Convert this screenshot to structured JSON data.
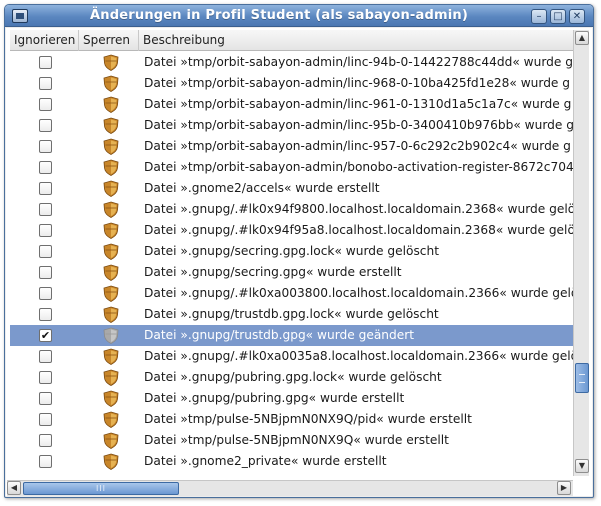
{
  "window": {
    "title": "Änderungen in Profil Student (als sabayon-admin)",
    "buttons": {
      "minimize": "–",
      "maximize": "□",
      "close": "✕"
    }
  },
  "columns": [
    "Ignorieren",
    "Sperren",
    "Beschreibung"
  ],
  "rows": [
    {
      "ignored": false,
      "lock": "shield-icon",
      "text": "Datei »tmp/orbit-sabayon-admin/linc-94b-0-14422788c44dd« wurde g"
    },
    {
      "ignored": false,
      "lock": "shield-icon",
      "text": "Datei »tmp/orbit-sabayon-admin/linc-968-0-10ba425fd1e28« wurde g"
    },
    {
      "ignored": false,
      "lock": "shield-icon",
      "text": "Datei »tmp/orbit-sabayon-admin/linc-961-0-1310d1a5c1a7c« wurde g"
    },
    {
      "ignored": false,
      "lock": "shield-icon",
      "text": "Datei »tmp/orbit-sabayon-admin/linc-95b-0-3400410b976bb« wurde g"
    },
    {
      "ignored": false,
      "lock": "shield-icon",
      "text": "Datei »tmp/orbit-sabayon-admin/linc-957-0-6c292c2b902c4« wurde g"
    },
    {
      "ignored": false,
      "lock": "shield-icon",
      "text": "Datei »tmp/orbit-sabayon-admin/bonobo-activation-register-8672c704"
    },
    {
      "ignored": false,
      "lock": "shield-icon",
      "text": "Datei ».gnome2/accels« wurde erstellt"
    },
    {
      "ignored": false,
      "lock": "shield-icon",
      "text": "Datei ».gnupg/.#lk0x94f9800.localhost.localdomain.2368« wurde gelö"
    },
    {
      "ignored": false,
      "lock": "shield-icon",
      "text": "Datei ».gnupg/.#lk0x94f95a8.localhost.localdomain.2368« wurde gelös"
    },
    {
      "ignored": false,
      "lock": "shield-icon",
      "text": "Datei ».gnupg/secring.gpg.lock« wurde gelöscht"
    },
    {
      "ignored": false,
      "lock": "shield-icon",
      "text": "Datei ».gnupg/secring.gpg« wurde erstellt"
    },
    {
      "ignored": false,
      "lock": "shield-icon",
      "text": "Datei ».gnupg/.#lk0xa003800.localhost.localdomain.2366« wurde gelö"
    },
    {
      "ignored": false,
      "lock": "shield-icon",
      "text": "Datei ».gnupg/trustdb.gpg.lock« wurde gelöscht"
    },
    {
      "ignored": true,
      "lock": "shield-icon-disabled",
      "text": "Datei ».gnupg/trustdb.gpg« wurde geändert",
      "selected": true
    },
    {
      "ignored": false,
      "lock": "shield-icon",
      "text": "Datei ».gnupg/.#lk0xa0035a8.localhost.localdomain.2366« wurde gelö"
    },
    {
      "ignored": false,
      "lock": "shield-icon",
      "text": "Datei ».gnupg/pubring.gpg.lock« wurde gelöscht"
    },
    {
      "ignored": false,
      "lock": "shield-icon",
      "text": "Datei ».gnupg/pubring.gpg« wurde erstellt"
    },
    {
      "ignored": false,
      "lock": "shield-icon",
      "text": "Datei »tmp/pulse-5NBjpmN0NX9Q/pid« wurde erstellt"
    },
    {
      "ignored": false,
      "lock": "shield-icon",
      "text": "Datei »tmp/pulse-5NBjpmN0NX9Q« wurde erstellt"
    },
    {
      "ignored": false,
      "lock": "shield-icon",
      "text": "Datei ».gnome2_private« wurde erstellt"
    }
  ],
  "checkmark": "✔",
  "scroll": {
    "vertical_position": 0.81,
    "horizontal_position": 0.0,
    "up": "▲",
    "down": "▼",
    "left": "◀",
    "right": "▶",
    "grip": "III"
  },
  "colors": {
    "selection": "#7b99cc",
    "titlebar": "#5b87c0",
    "shield": "#c8862a",
    "shield_disabled": "#a9a9a9"
  }
}
